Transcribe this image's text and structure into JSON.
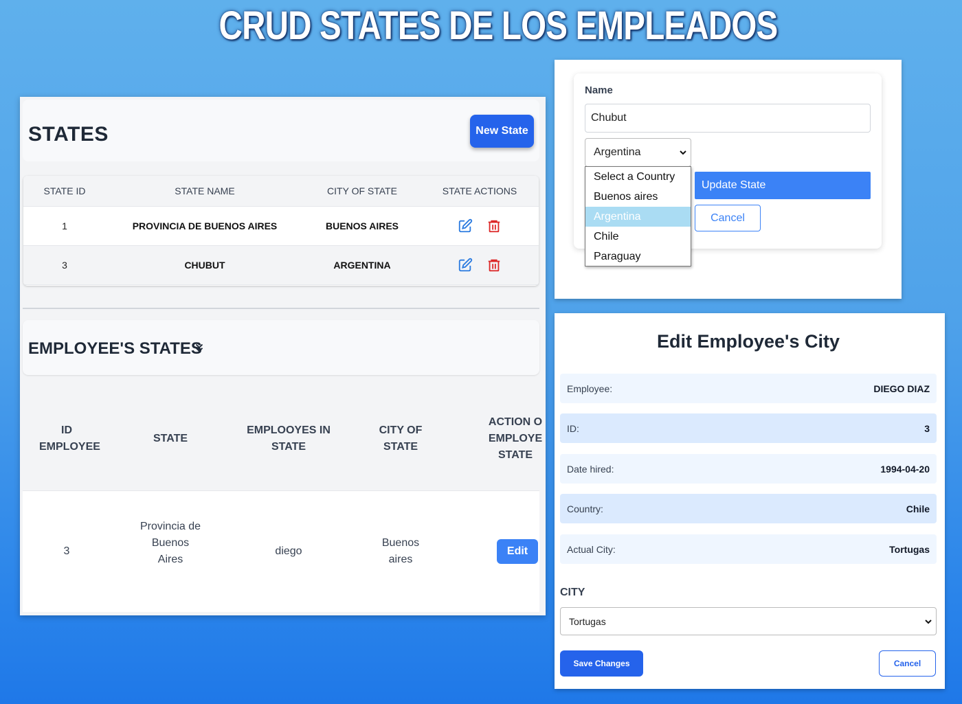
{
  "page_title": "CRUD STATES DE LOS EMPLEADOS",
  "states_section": {
    "title": "STATES",
    "new_button": "New State",
    "columns": [
      "STATE ID",
      "STATE NAME",
      "CITY OF STATE",
      "STATE ACTIONS"
    ],
    "rows": [
      {
        "id": "1",
        "name": "PROVINCIA DE BUENOS AIRES",
        "city": "BUENOS AIRES"
      },
      {
        "id": "3",
        "name": "CHUBUT",
        "city": "ARGENTINA"
      }
    ],
    "edit_icon": "edit-icon",
    "delete_icon": "trash-icon"
  },
  "employee_section": {
    "title": "EMPLOYEE'S STATES",
    "toggle_icon": "chevron-double-down-icon",
    "columns": [
      "ID EMPLOYEE",
      "STATE",
      "EMPLOOYES IN STATE",
      "CITY OF STATE",
      "ACTION O EMPLOYE STATE"
    ],
    "rows": [
      {
        "id": "3",
        "state": "Provincia de Buenos Aires",
        "employee": "diego",
        "city": "Buenos aires",
        "action_label": "Edit"
      }
    ]
  },
  "state_form": {
    "name_label": "Name",
    "name_value": "Chubut",
    "country_selected": "Argentina",
    "country_options": [
      "Select a Country",
      "Buenos aires",
      "Argentina",
      "Chile",
      "Paraguay"
    ],
    "update_button": "Update State",
    "cancel_button": "Cancel"
  },
  "edit_city_modal": {
    "title": "Edit Employee's City",
    "fields": [
      {
        "label": "Employee:",
        "value": "DIEGO DIAZ"
      },
      {
        "label": "ID:",
        "value": "3"
      },
      {
        "label": "Date hired:",
        "value": "1994-04-20"
      },
      {
        "label": "Country:",
        "value": "Chile"
      },
      {
        "label": "Actual City:",
        "value": "Tortugas"
      }
    ],
    "city_label": "CITY",
    "city_selected": "Tortugas",
    "save_button": "Save Changes",
    "cancel_button": "Cancel"
  },
  "colors": {
    "primary": "#2563eb",
    "accent": "#3b82f6",
    "danger": "#dc2626",
    "dropdown_highlight": "#aadcf3"
  }
}
